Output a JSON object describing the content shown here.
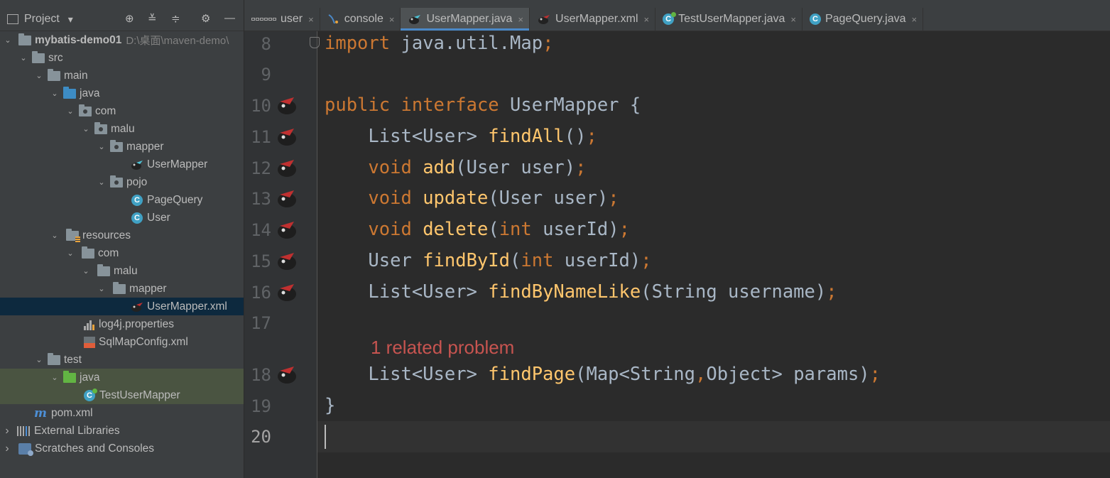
{
  "project_panel": {
    "title": "Project",
    "title_dropdown": "▾",
    "toolbar_icons": [
      "locate-icon",
      "expand-all-icon",
      "collapse-all-icon",
      "gear-icon",
      "minimize-icon"
    ]
  },
  "tree": [
    {
      "label": "mybatis-demo01",
      "extra": "D:\\桌面\\maven-demo\\",
      "arrow": "⌄",
      "icon": "module-folder"
    },
    {
      "label": "src",
      "arrow": "⌄",
      "icon": "folder"
    },
    {
      "label": "main",
      "arrow": "⌄",
      "icon": "folder"
    },
    {
      "label": "java",
      "arrow": "⌄",
      "icon": "source-folder"
    },
    {
      "label": "com",
      "arrow": "⌄",
      "icon": "package"
    },
    {
      "label": "malu",
      "arrow": "⌄",
      "icon": "package"
    },
    {
      "label": "mapper",
      "arrow": "⌄",
      "icon": "package"
    },
    {
      "label": "UserMapper",
      "icon": "mybatis-java"
    },
    {
      "label": "pojo",
      "arrow": "⌄",
      "icon": "package"
    },
    {
      "label": "PageQuery",
      "icon": "class"
    },
    {
      "label": "User",
      "icon": "class"
    },
    {
      "label": "resources",
      "arrow": "⌄",
      "icon": "resources-folder"
    },
    {
      "label": "com",
      "arrow": "⌄",
      "icon": "folder"
    },
    {
      "label": "malu",
      "arrow": "⌄",
      "icon": "folder"
    },
    {
      "label": "mapper",
      "arrow": "⌄",
      "icon": "folder"
    },
    {
      "label": "UserMapper.xml",
      "icon": "mybatis-xml",
      "selected": true
    },
    {
      "label": "log4j.properties",
      "icon": "properties"
    },
    {
      "label": "SqlMapConfig.xml",
      "icon": "xml"
    },
    {
      "label": "test",
      "arrow": "⌄",
      "icon": "folder"
    },
    {
      "label": "java",
      "arrow": "⌄",
      "icon": "test-folder"
    },
    {
      "label": "TestUserMapper",
      "icon": "test-class"
    },
    {
      "label": "pom.xml",
      "icon": "maven",
      "mvn_glyph": "m"
    },
    {
      "label": "External Libraries",
      "arrow": "›",
      "icon": "libraries"
    },
    {
      "label": "Scratches and Consoles",
      "arrow": "›",
      "icon": "scratches"
    }
  ],
  "tabs": [
    {
      "label": "user",
      "icon": "table-icon",
      "close": "×"
    },
    {
      "label": "console",
      "icon": "console-icon",
      "close": "×"
    },
    {
      "label": "UserMapper.java",
      "icon": "mybatis-java-icon",
      "close": "×",
      "active": true
    },
    {
      "label": "UserMapper.xml",
      "icon": "mybatis-xml-icon",
      "close": "×"
    },
    {
      "label": "TestUserMapper.java",
      "icon": "test-class-icon",
      "close": "×"
    },
    {
      "label": "PageQuery.java",
      "icon": "class-icon",
      "close": "×"
    }
  ],
  "class_icon_letter": "C",
  "editor": {
    "line_numbers": [
      "8",
      "9",
      "10",
      "11",
      "12",
      "13",
      "14",
      "15",
      "16",
      "17",
      "18",
      "19",
      "20"
    ],
    "problem_hint": "1 related problem",
    "code": {
      "l8_a": "import",
      "l8_b": " java.util.Map",
      "l8_c": ";",
      "l10_a": "public",
      "l10_b": " ",
      "l10_c": "interface",
      "l10_d": " UserMapper {",
      "l11_a": "    List<User> ",
      "l11_b": "findAll",
      "l11_c": "()",
      "l11_d": ";",
      "l12_a": "    ",
      "l12_b": "void",
      "l12_c": " ",
      "l12_d": "add",
      "l12_e": "(User user)",
      "l12_f": ";",
      "l13_a": "    ",
      "l13_b": "void",
      "l13_c": " ",
      "l13_d": "update",
      "l13_e": "(User user)",
      "l13_f": ";",
      "l14_a": "    ",
      "l14_b": "void",
      "l14_c": " ",
      "l14_d": "delete",
      "l14_e": "(",
      "l14_f": "int",
      "l14_g": " userId)",
      "l14_h": ";",
      "l15_a": "    User ",
      "l15_b": "findById",
      "l15_c": "(",
      "l15_d": "int",
      "l15_e": " userId)",
      "l15_f": ";",
      "l16_a": "    List<User> ",
      "l16_b": "findByNameLike",
      "l16_c": "(String username)",
      "l16_d": ";",
      "l18_a": "    List<User> ",
      "l18_b": "findPage",
      "l18_c": "(Map<String",
      "l18_d": ",",
      "l18_e": "Object> params)",
      "l18_f": ";",
      "l19_a": "}"
    }
  },
  "colors": {
    "keyword": "#cc7832",
    "method": "#ffc66d",
    "text": "#a9b7c6",
    "problem": "#c75450",
    "selection": "#0d293e",
    "tab_underline": "#4a88c7"
  }
}
